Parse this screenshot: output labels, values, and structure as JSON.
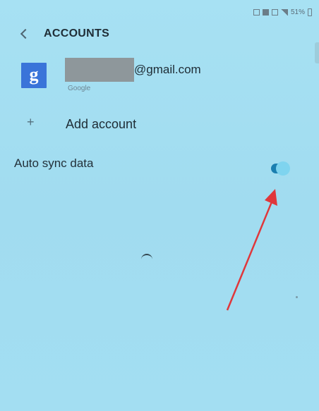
{
  "status_bar": {
    "battery_text": "51%",
    "icons": [
      "notification-icon",
      "sim-icon",
      "wifi-icon",
      "signal-icon",
      "battery-icon"
    ]
  },
  "header": {
    "title": "ACCOUNTS",
    "back_icon": "chevron-left-icon"
  },
  "account": {
    "icon": "google-g-icon",
    "icon_letter": "g",
    "email_domain": "@gmail.com",
    "type": "Google"
  },
  "add_account": {
    "label": "Add account",
    "icon": "plus-icon"
  },
  "auto_sync": {
    "label": "Auto sync data",
    "enabled": true
  },
  "colors": {
    "background": "#a4dff2",
    "toggle_on": "#1b7fb0",
    "google_blue": "#3a74d9",
    "annotation_arrow": "#e0373b"
  }
}
